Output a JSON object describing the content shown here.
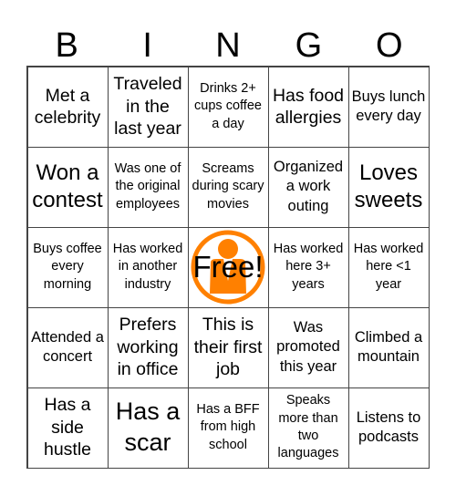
{
  "header": {
    "letters": [
      "B",
      "I",
      "N",
      "G",
      "O"
    ]
  },
  "colors": {
    "accent": "#FF8000",
    "grid_line": "#444444"
  },
  "cells": [
    {
      "text": "Met a celebrity",
      "size": "s3"
    },
    {
      "text": "Traveled in the last year",
      "size": "s3"
    },
    {
      "text": "Drinks 2+ cups coffee a day",
      "size": "s1"
    },
    {
      "text": "Has food allergies",
      "size": "s3"
    },
    {
      "text": "Buys lunch every day",
      "size": "s2"
    },
    {
      "text": "Won a contest",
      "size": "s4"
    },
    {
      "text": "Was one of the original employees",
      "size": "s1"
    },
    {
      "text": "Screams during scary movies",
      "size": "s1"
    },
    {
      "text": "Organized a work outing",
      "size": "s2"
    },
    {
      "text": "Loves sweets",
      "size": "s4"
    },
    {
      "text": "Buys coffee every morning",
      "size": "s1"
    },
    {
      "text": "Has worked in another industry",
      "size": "s1"
    },
    {
      "text": "Free!",
      "size": "free",
      "icon": "person-icon"
    },
    {
      "text": "Has worked here 3+ years",
      "size": "s1"
    },
    {
      "text": "Has worked here <1 year",
      "size": "s1"
    },
    {
      "text": "Attended a concert",
      "size": "s2"
    },
    {
      "text": "Prefers working in office",
      "size": "s3"
    },
    {
      "text": "This is their first job",
      "size": "s3"
    },
    {
      "text": "Was promoted this year",
      "size": "s2"
    },
    {
      "text": "Climbed a mountain",
      "size": "s2"
    },
    {
      "text": "Has a side hustle",
      "size": "s3"
    },
    {
      "text": "Has a scar",
      "size": "s5"
    },
    {
      "text": "Has a BFF from high school",
      "size": "s1"
    },
    {
      "text": "Speaks more than two languages",
      "size": "s1"
    },
    {
      "text": "Listens to podcasts",
      "size": "s2"
    }
  ]
}
